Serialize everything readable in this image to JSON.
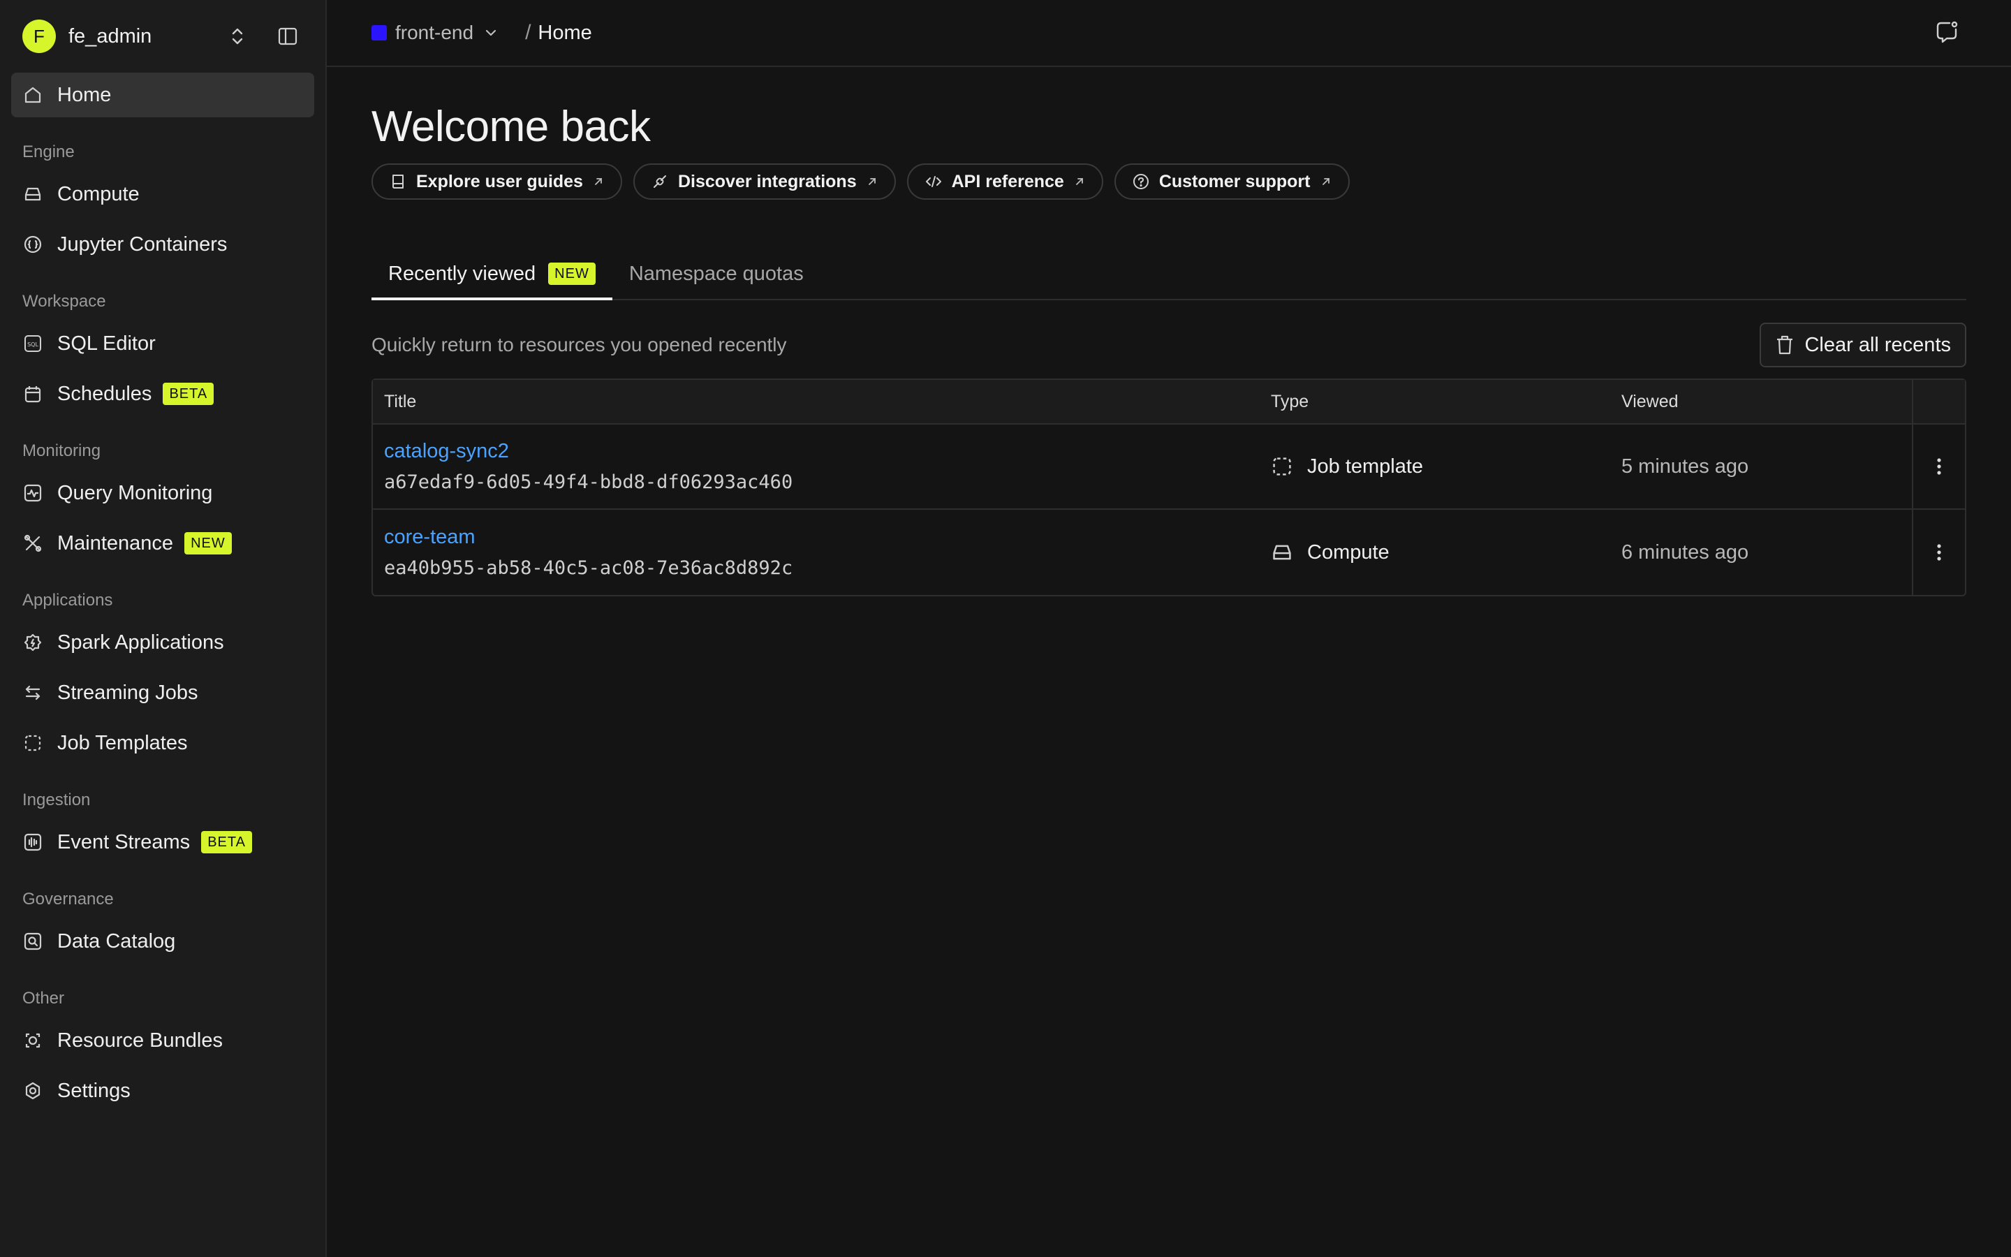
{
  "sidebar": {
    "org": {
      "initial": "F",
      "name": "fe_admin"
    },
    "home_label": "Home",
    "sections": [
      {
        "label": "Engine",
        "items": [
          {
            "label": "Compute"
          },
          {
            "label": "Jupyter Containers"
          }
        ]
      },
      {
        "label": "Workspace",
        "items": [
          {
            "label": "SQL Editor"
          },
          {
            "label": "Schedules",
            "badge": "BETA"
          }
        ]
      },
      {
        "label": "Monitoring",
        "items": [
          {
            "label": "Query Monitoring"
          },
          {
            "label": "Maintenance",
            "badge": "NEW"
          }
        ]
      },
      {
        "label": "Applications",
        "items": [
          {
            "label": "Spark Applications"
          },
          {
            "label": "Streaming Jobs"
          },
          {
            "label": "Job Templates"
          }
        ]
      },
      {
        "label": "Ingestion",
        "items": [
          {
            "label": "Event Streams",
            "badge": "BETA"
          }
        ]
      },
      {
        "label": "Governance",
        "items": [
          {
            "label": "Data Catalog"
          }
        ]
      },
      {
        "label": "Other",
        "items": [
          {
            "label": "Resource Bundles"
          },
          {
            "label": "Settings"
          }
        ]
      }
    ]
  },
  "topbar": {
    "project": "front-end",
    "separator": "/",
    "current": "Home",
    "project_color": "#2b14ff"
  },
  "main": {
    "title": "Welcome back",
    "quick_links": [
      {
        "label": "Explore user guides"
      },
      {
        "label": "Discover integrations"
      },
      {
        "label": "API reference"
      },
      {
        "label": "Customer support"
      }
    ],
    "tabs": [
      {
        "label": "Recently viewed",
        "badge": "NEW"
      },
      {
        "label": "Namespace quotas"
      }
    ],
    "subtitle": "Quickly return to resources you opened recently",
    "clear_button": "Clear all recents",
    "table": {
      "headers": {
        "title": "Title",
        "type": "Type",
        "viewed": "Viewed"
      },
      "rows": [
        {
          "name": "catalog-sync2",
          "id": "a67edaf9-6d05-49f4-bbd8-df06293ac460",
          "type": "Job template",
          "viewed": "5 minutes ago"
        },
        {
          "name": "core-team",
          "id": "ea40b955-ab58-40c5-ac08-7e36ac8d892c",
          "type": "Compute",
          "viewed": "6 minutes ago"
        }
      ]
    }
  },
  "colors": {
    "accent": "#d6f52a",
    "link": "#4aa3ff",
    "background": "#141414",
    "sidebar": "#1c1c1c"
  }
}
